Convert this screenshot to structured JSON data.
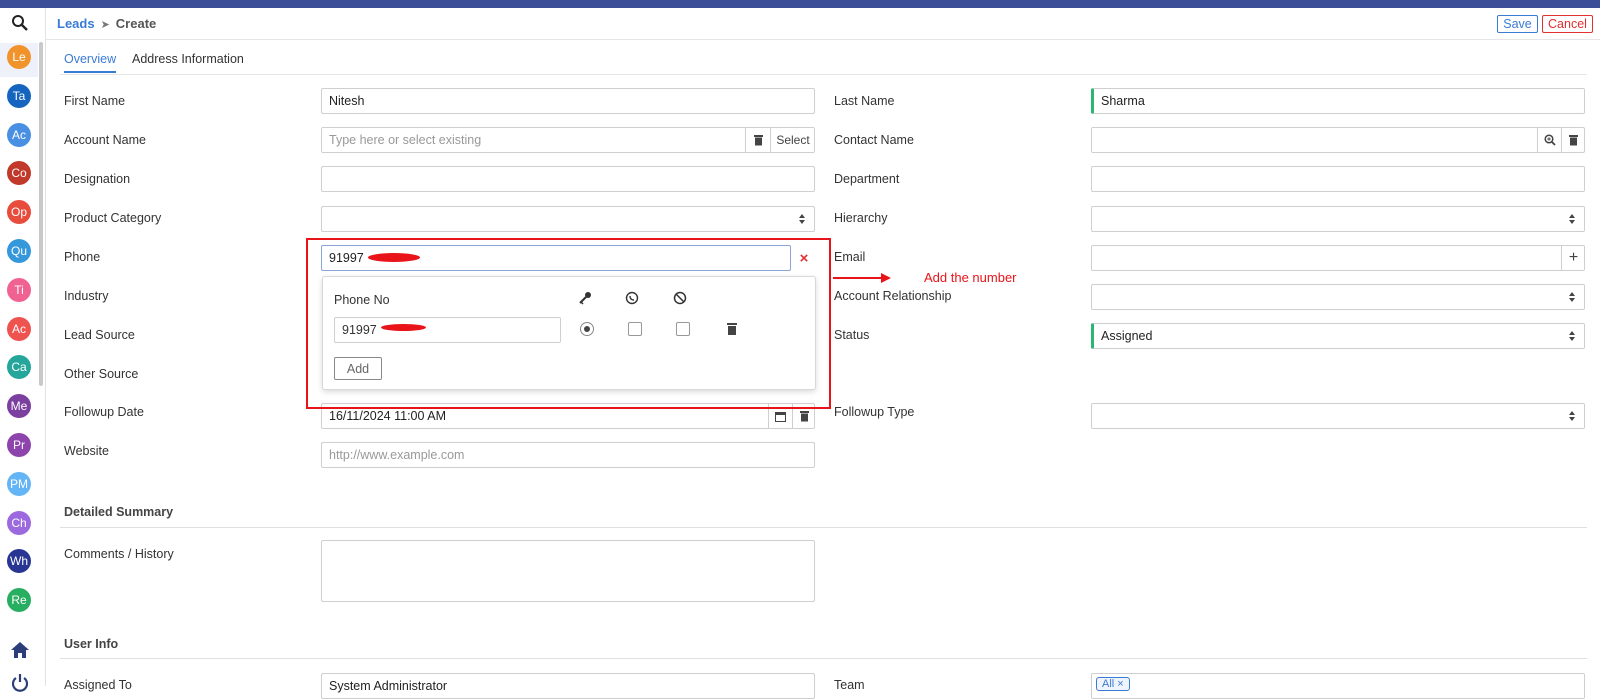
{
  "header": {
    "breadcrumb_link": "Leads",
    "breadcrumb_current": "Create",
    "save_label": "Save",
    "cancel_label": "Cancel"
  },
  "sidebar": {
    "items": [
      {
        "label": "Le",
        "color": "#f0932b"
      },
      {
        "label": "Ta",
        "color": "#1565c0"
      },
      {
        "label": "Ac",
        "color": "#4a90e2"
      },
      {
        "label": "Co",
        "color": "#c0392b"
      },
      {
        "label": "Op",
        "color": "#e74c3c"
      },
      {
        "label": "Qu",
        "color": "#3498db"
      },
      {
        "label": "Ti",
        "color": "#f06292"
      },
      {
        "label": "Ac",
        "color": "#ef5350"
      },
      {
        "label": "Ca",
        "color": "#26a69a"
      },
      {
        "label": "Me",
        "color": "#7b3fa0"
      },
      {
        "label": "Pr",
        "color": "#8e44ad"
      },
      {
        "label": "PM",
        "color": "#64b5f6"
      },
      {
        "label": "Ch",
        "color": "#9c6ade"
      },
      {
        "label": "Wh",
        "color": "#283593"
      },
      {
        "label": "Re",
        "color": "#27ae60"
      }
    ]
  },
  "tabs": [
    "Overview",
    "Address Information"
  ],
  "form": {
    "first_name_label": "First Name",
    "first_name_value": "Nitesh",
    "last_name_label": "Last Name",
    "last_name_value": "Sharma",
    "account_name_label": "Account Name",
    "account_name_placeholder": "Type here or select existing",
    "select_label": "Select",
    "contact_name_label": "Contact Name",
    "designation_label": "Designation",
    "department_label": "Department",
    "product_category_label": "Product Category",
    "hierarchy_label": "Hierarchy",
    "phone_label": "Phone",
    "phone_value": "91997",
    "email_label": "Email",
    "industry_label": "Industry",
    "account_relationship_label": "Account Relationship",
    "lead_source_label": "Lead Source",
    "status_label": "Status",
    "status_value": "Assigned",
    "other_source_label": "Other Source",
    "followup_date_label": "Followup Date",
    "followup_date_value": "16/11/2024 11:00 AM",
    "followup_type_label": "Followup Type",
    "website_label": "Website",
    "website_placeholder": "http://www.example.com",
    "detailed_summary_title": "Detailed Summary",
    "comments_label": "Comments / History",
    "user_info_title": "User Info",
    "assigned_to_label": "Assigned To",
    "assigned_to_value": "System Administrator",
    "team_label": "Team",
    "team_tag": "All"
  },
  "phone_popup": {
    "header": "Phone No",
    "row_value": "91997",
    "add_label": "Add"
  },
  "annotation": {
    "text": "Add the number",
    "color": "#e8141a"
  }
}
